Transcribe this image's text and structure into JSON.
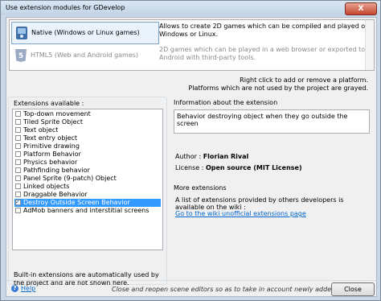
{
  "window": {
    "title": "Use extension modules for GDevelop",
    "close_glyph": "X"
  },
  "platforms": [
    {
      "name": "Native (Windows or Linux games)",
      "description": "Allows to create 2D games which can be compiled and played on Windows or Linux.",
      "icon": "native-platform-icon"
    },
    {
      "name": "HTML5 (Web and Android games)",
      "description": "2D games which can be played in a web browser or exported to Android with third-party tools.",
      "icon": "html5-icon"
    }
  ],
  "hints": {
    "line1": "Right click to add or remove a platform.",
    "line2": "Platforms which are not used by the project are grayed."
  },
  "extensions": {
    "label": "Extensions available :",
    "items": [
      {
        "label": "Top-down movement",
        "checked": false
      },
      {
        "label": "Tiled Sprite Object",
        "checked": false
      },
      {
        "label": "Text object",
        "checked": false
      },
      {
        "label": "Text entry object",
        "checked": false
      },
      {
        "label": "Primitive drawing",
        "checked": false
      },
      {
        "label": "Platform Behavior",
        "checked": false
      },
      {
        "label": "Physics behavior",
        "checked": false
      },
      {
        "label": "Pathfinding behavior",
        "checked": false
      },
      {
        "label": "Panel Sprite (9-patch) Object",
        "checked": false
      },
      {
        "label": "Linked objects",
        "checked": false
      },
      {
        "label": "Draggable Behavior",
        "checked": false
      },
      {
        "label": "Destroy Outside Screen Behavior",
        "checked": true,
        "selected": true
      },
      {
        "label": "AdMob banners and interstitial screens",
        "checked": false
      }
    ],
    "builtin_note": "Built-in extensions are automatically used by the project and are not shown here."
  },
  "info": {
    "label": "Information about the extension",
    "description": "Behavior destroying object when they go outside the screen",
    "author_label": "Author :",
    "author": "Florian Rival",
    "license_label": "License :",
    "license": "Open source (MIT License)",
    "more_label": "More extensions",
    "more_text": "A list of extensions provided by others developers is available on the wiki :",
    "wiki_link": "Go to the wiki unofficial extensions page"
  },
  "footer": {
    "help": "Help",
    "reopen_note": "Close and reopen scene editors so as to take in account newly added extensions.",
    "close_button": "Close"
  }
}
